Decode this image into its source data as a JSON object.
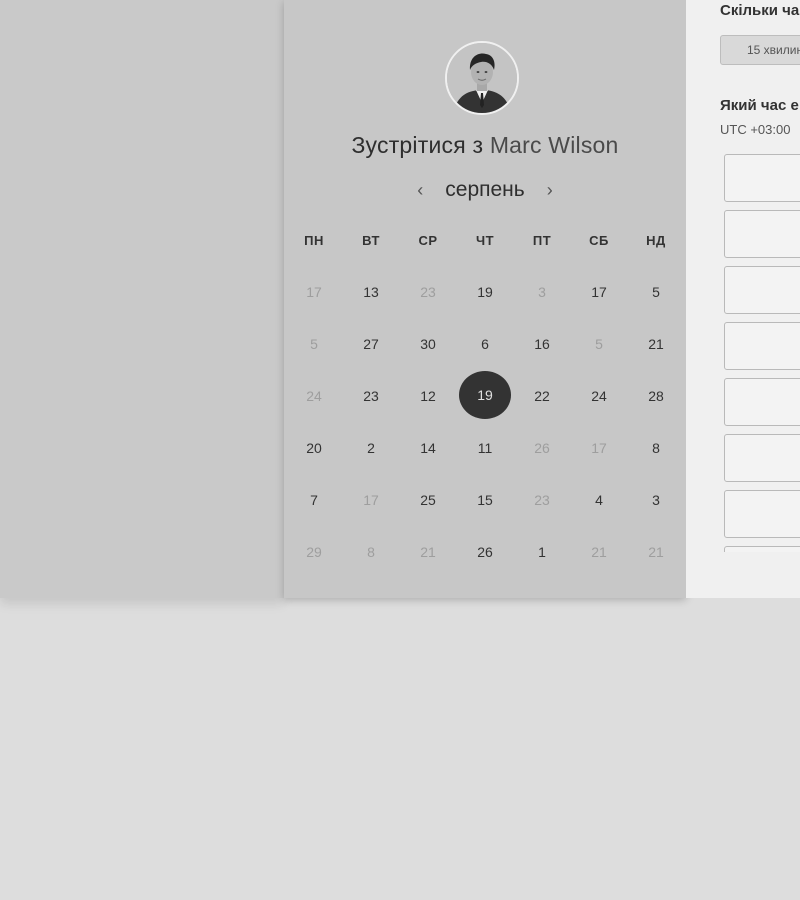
{
  "meeting": {
    "prefix": "Зустрітися з",
    "host_name": "Marc Wilson"
  },
  "calendar": {
    "month": "серпень",
    "prev_symbol": "‹",
    "next_symbol": "›",
    "weekdays": [
      "ПН",
      "ВТ",
      "СР",
      "ЧТ",
      "ПТ",
      "СБ",
      "НД"
    ],
    "weeks": [
      [
        {
          "d": "17",
          "m": true
        },
        {
          "d": "13",
          "m": false
        },
        {
          "d": "23",
          "m": true
        },
        {
          "d": "19",
          "m": false
        },
        {
          "d": "3",
          "m": true
        },
        {
          "d": "17",
          "m": false
        },
        {
          "d": "5",
          "m": false
        }
      ],
      [
        {
          "d": "5",
          "m": true
        },
        {
          "d": "27",
          "m": false
        },
        {
          "d": "30",
          "m": false
        },
        {
          "d": "6",
          "m": false
        },
        {
          "d": "16",
          "m": false
        },
        {
          "d": "5",
          "m": true
        },
        {
          "d": "21",
          "m": false
        }
      ],
      [
        {
          "d": "24",
          "m": true
        },
        {
          "d": "23",
          "m": false
        },
        {
          "d": "12",
          "m": false
        },
        {
          "d": "19",
          "m": false,
          "sel": true
        },
        {
          "d": "22",
          "m": false
        },
        {
          "d": "24",
          "m": false
        },
        {
          "d": "28",
          "m": false
        }
      ],
      [
        {
          "d": "20",
          "m": false
        },
        {
          "d": "2",
          "m": false
        },
        {
          "d": "14",
          "m": false
        },
        {
          "d": "11",
          "m": false
        },
        {
          "d": "26",
          "m": true
        },
        {
          "d": "17",
          "m": true
        },
        {
          "d": "8",
          "m": false
        }
      ],
      [
        {
          "d": "7",
          "m": false
        },
        {
          "d": "17",
          "m": true
        },
        {
          "d": "25",
          "m": false
        },
        {
          "d": "15",
          "m": false
        },
        {
          "d": "23",
          "m": true
        },
        {
          "d": "4",
          "m": false
        },
        {
          "d": "3",
          "m": false
        }
      ],
      [
        {
          "d": "29",
          "m": true
        },
        {
          "d": "8",
          "m": true
        },
        {
          "d": "21",
          "m": true
        },
        {
          "d": "26",
          "m": false
        },
        {
          "d": "1",
          "m": false
        },
        {
          "d": "21",
          "m": true
        },
        {
          "d": "21",
          "m": true
        }
      ]
    ]
  },
  "booking": {
    "duration_heading": "Скільки ча",
    "duration_value": "15 хвилин",
    "time_heading": "Який час е",
    "timezone": "UTC +03:00"
  },
  "colors": {
    "selected_day_bg": "#333333",
    "panel_bg": "#c7c7c7",
    "right_panel_bg": "#f0f0f0"
  }
}
